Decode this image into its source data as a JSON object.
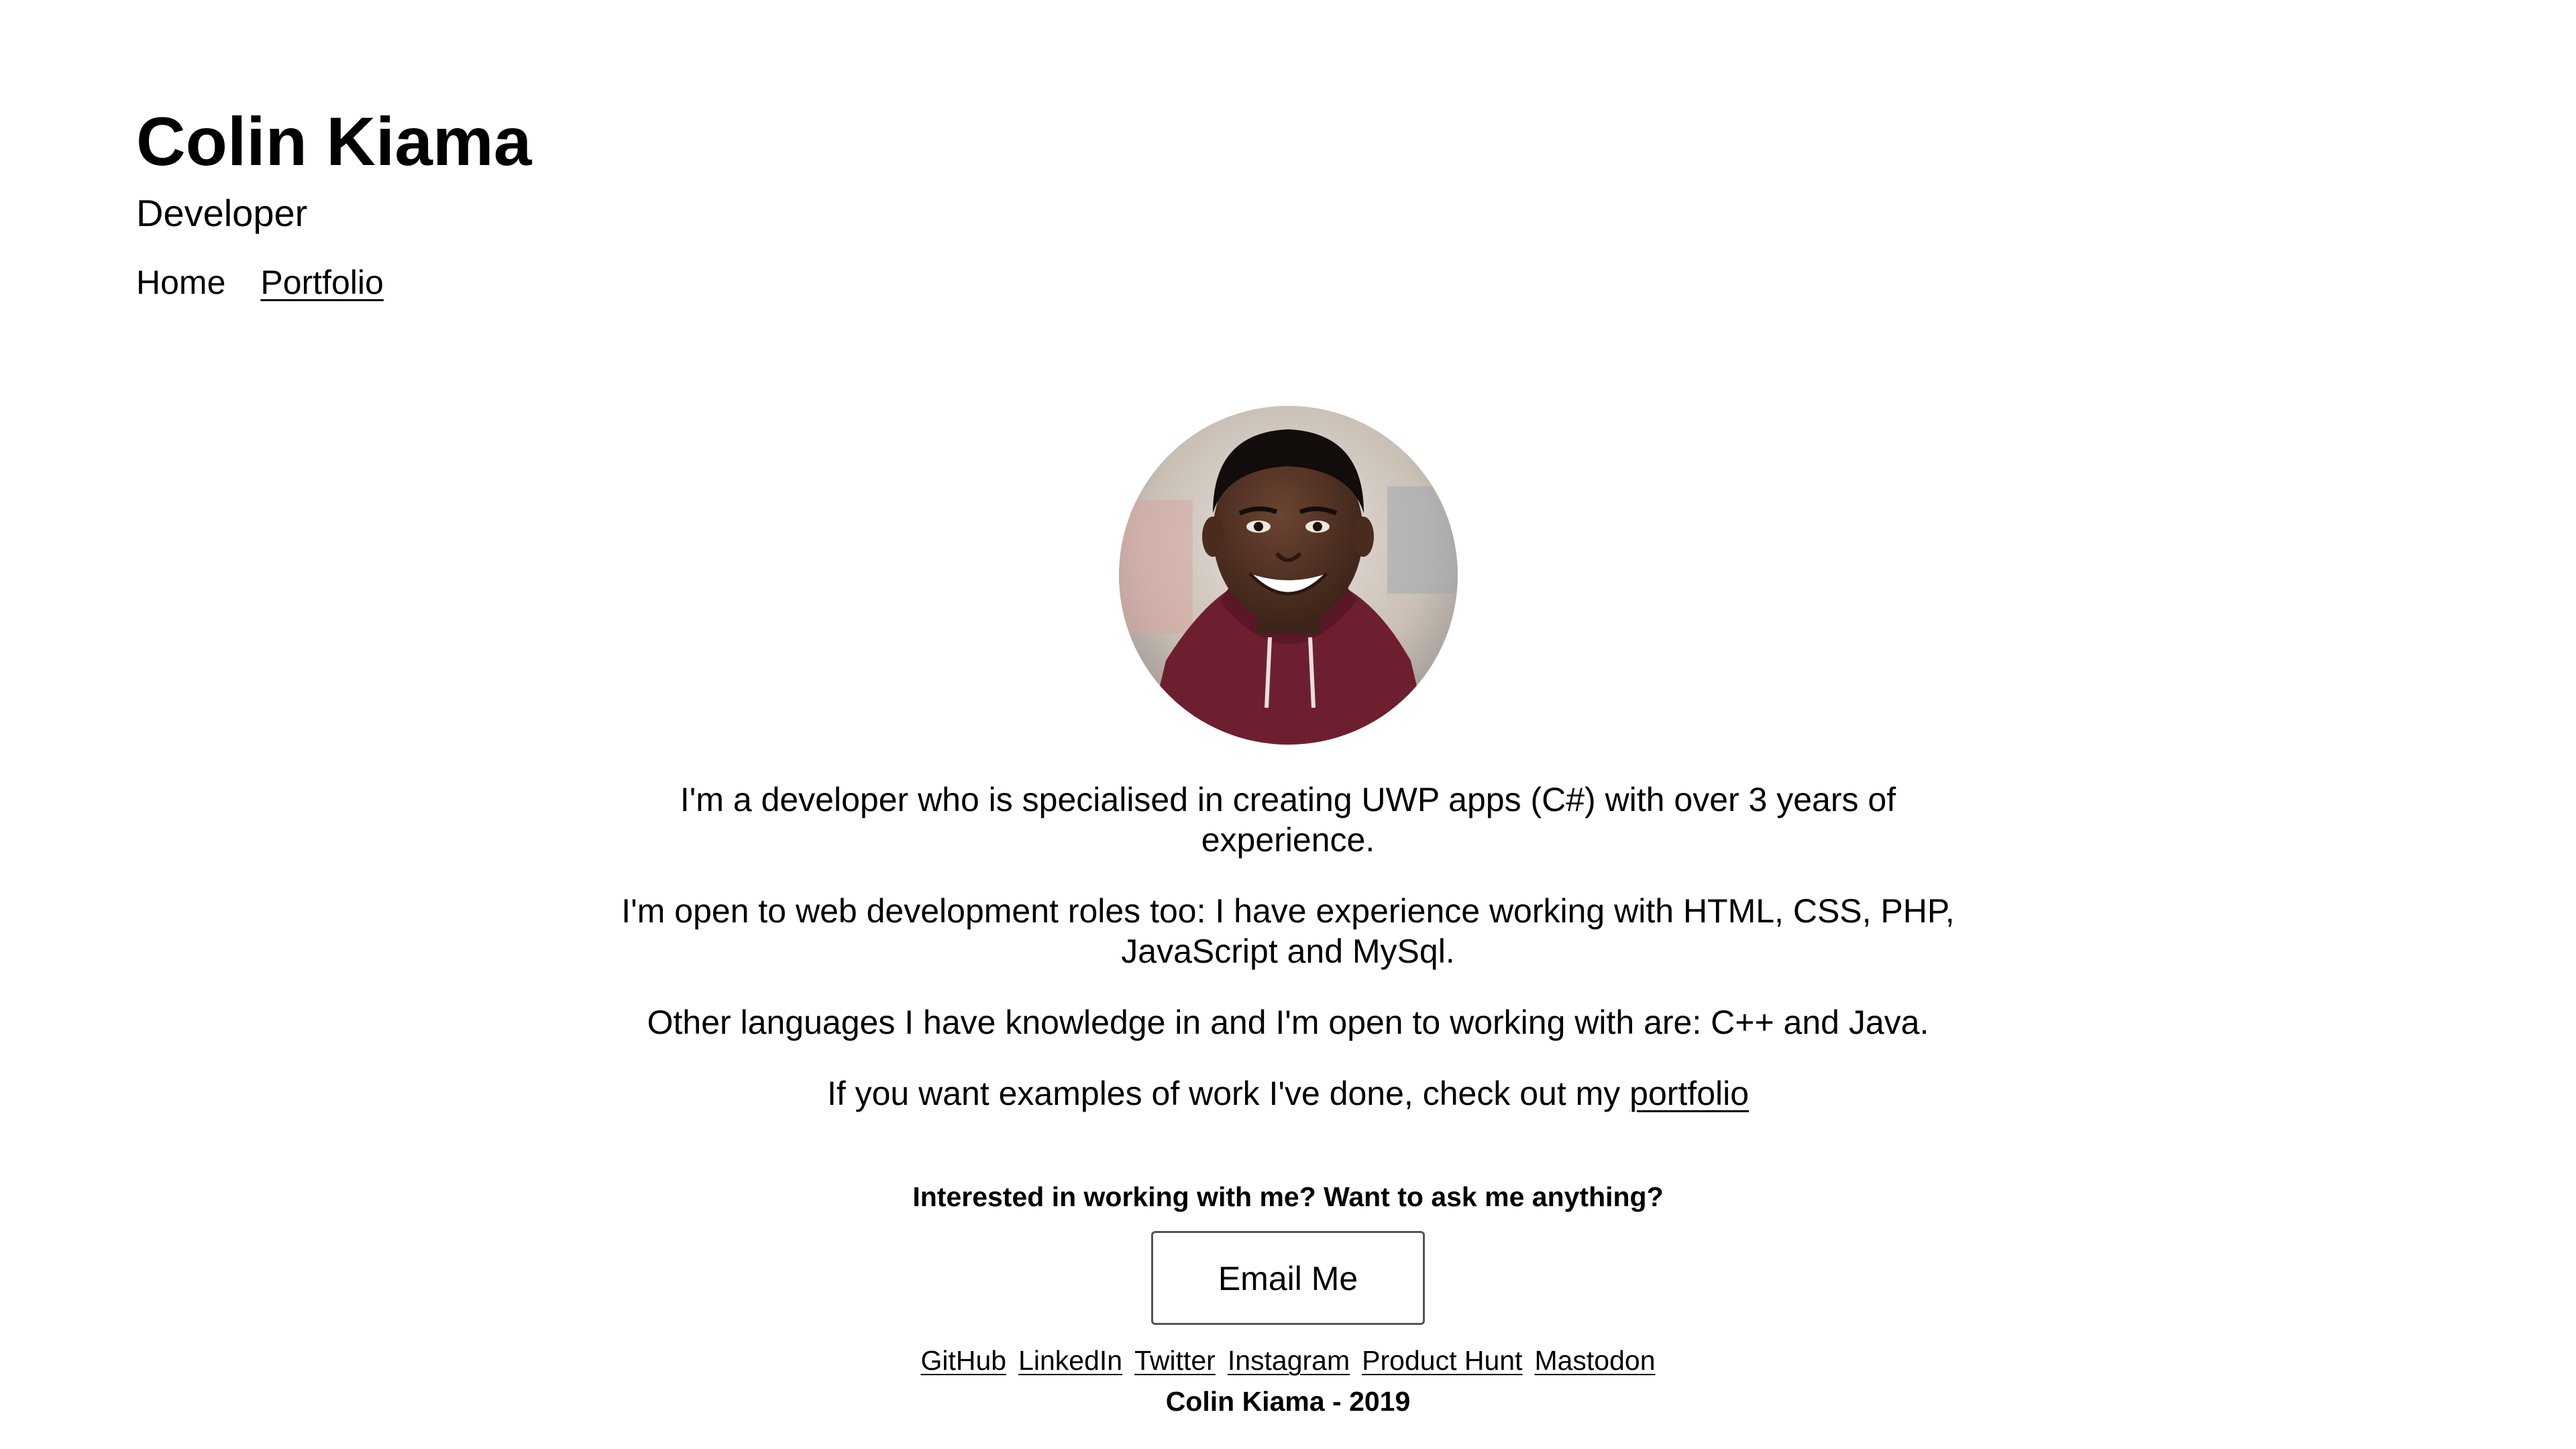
{
  "header": {
    "title": "Colin Kiama",
    "subtitle": "Developer",
    "nav": [
      {
        "label": "Home"
      },
      {
        "label": "Portfolio"
      }
    ]
  },
  "main": {
    "bio": [
      "I'm a developer who is specialised in creating UWP apps (C#) with over 3 years of experience.",
      "I'm open to web development roles too: I have experience working with HTML, CSS, PHP, JavaScript and MySql.",
      "Other languages I have knowledge in and I'm open to working with are: C++ and Java.",
      "If you want examples of work I've done, check out my"
    ],
    "portfolio_link": "portfolio"
  },
  "contact": {
    "heading": "Interested in working with me? Want to ask me anything?",
    "button_label": "Email Me"
  },
  "footer": {
    "links": [
      "GitHub",
      "LinkedIn",
      "Twitter",
      "Instagram",
      "Product Hunt",
      "Mastodon"
    ],
    "copyright": "Colin Kiama - 2019"
  },
  "colors": {
    "background": "#ffffff",
    "text": "#000000",
    "hoodie": "#6e1f2f"
  }
}
